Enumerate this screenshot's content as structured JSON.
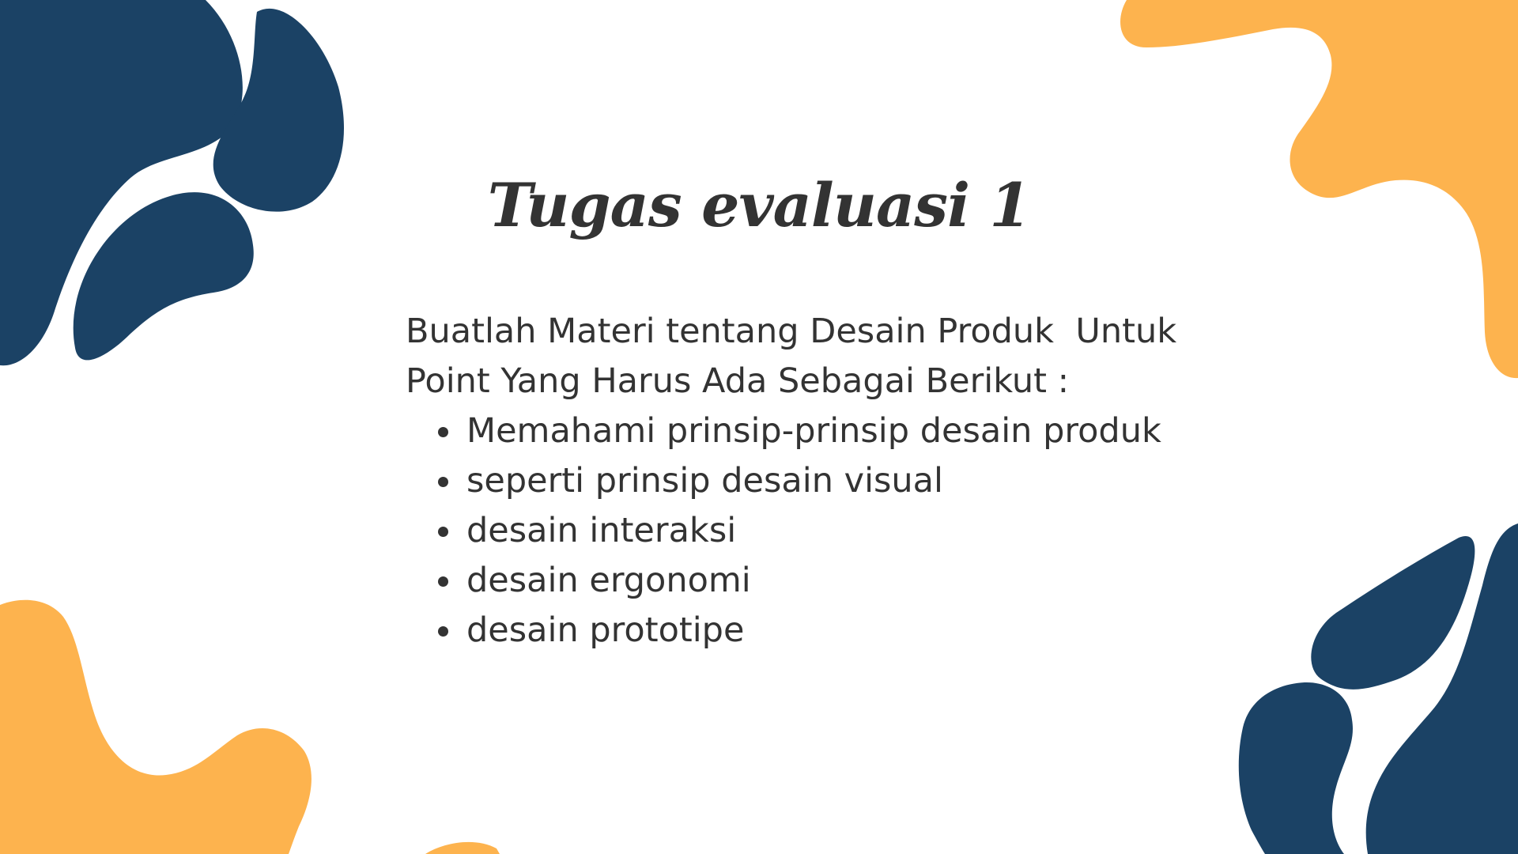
{
  "colors": {
    "navy": "#1B4265",
    "orange": "#FDB34E",
    "text": "#333333",
    "background": "#FFFFFF"
  },
  "title": "Tugas evaluasi 1",
  "intro_lines": [
    "Buatlah Materi tentang Desain Produk  Untuk",
    "Point Yang Harus Ada Sebagai Berikut :"
  ],
  "bullets": [
    "Memahami prinsip-prinsip desain produk",
    "seperti prinsip desain visual",
    "desain interaksi",
    "desain ergonomi",
    "desain prototipe"
  ]
}
